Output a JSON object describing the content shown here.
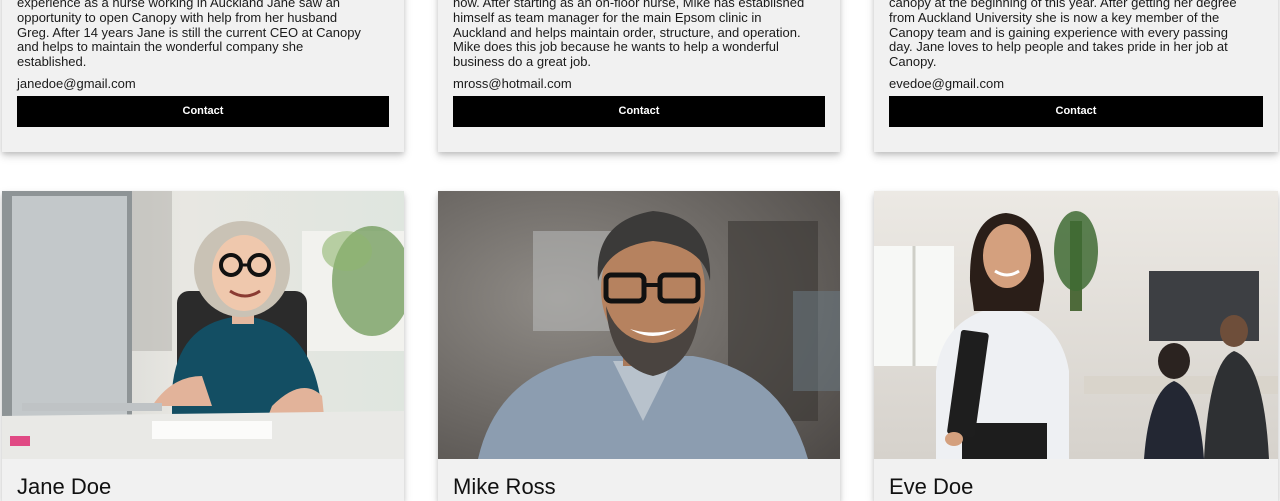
{
  "team": [
    {
      "name": "Jane Doe",
      "bio": "experience as a nurse working in Auckland Jane saw an\nopportunity to open Canopy with help from her husband\nGreg. After 14 years Jane is still the current CEO at Canopy\nand helps to maintain the wonderful company she\nestablished.",
      "email": "janedoe@gmail.com",
      "contact_label": "Contact",
      "photo_icon": "portrait-photo-woman-glasses"
    },
    {
      "name": "Mike Ross",
      "bio": "now. After starting as an on-floor nurse, Mike has established\nhimself as team manager for the main Epsom clinic in\nAuckland and helps maintain order, structure, and operation.\nMike does this job because he wants to help a wonderful\nbusiness do a great job.",
      "email": "mross@hotmail.com",
      "contact_label": "Contact",
      "photo_icon": "portrait-photo-man-glasses"
    },
    {
      "name": "Eve Doe",
      "bio": "canopy at the beginning of this year. After getting her degree\nfrom Auckland University she is now a key member of the\nCanopy team and is gaining experience with every passing\nday. Jane loves to help people and takes pride in her job at\nCanopy.",
      "email": "evedoe@gmail.com",
      "contact_label": "Contact",
      "photo_icon": "portrait-photo-woman-folder"
    }
  ],
  "colors": {
    "card_bg": "#f1f1f1",
    "button_bg": "#000000",
    "button_text": "#ffffff"
  }
}
